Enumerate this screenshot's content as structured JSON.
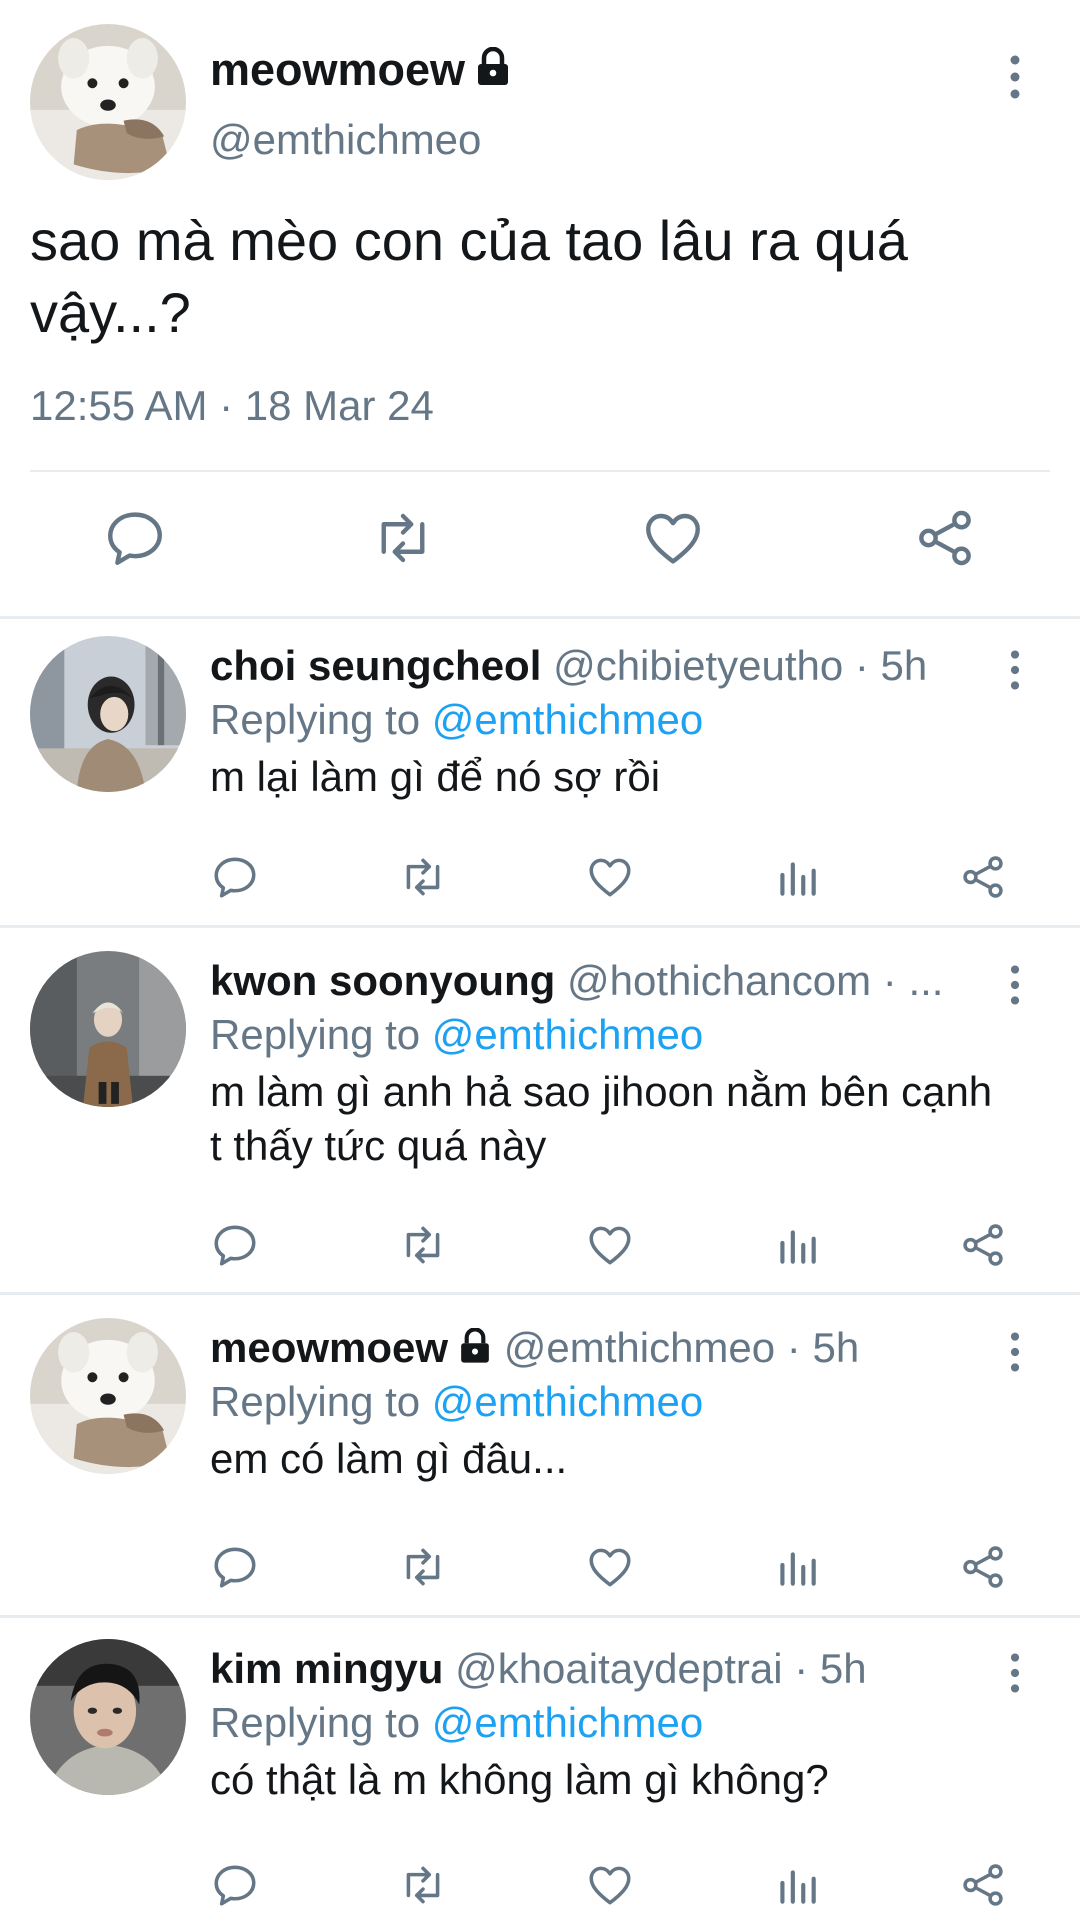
{
  "main_tweet": {
    "display_name": "meowmoew",
    "handle": "@emthichmeo",
    "text": "sao mà mèo con của tao lâu ra quá vậy...?",
    "timestamp": "12:55 AM · 18 Mar 24",
    "protected_icon": "lock-icon",
    "actions": [
      "reply-icon",
      "retweet-icon",
      "like-icon",
      "share-icon"
    ]
  },
  "replies": [
    {
      "display_name": "choi seungcheol",
      "meta": "@chibietyeutho · 5h",
      "replying_prefix": "Replying to",
      "replying_to": "@emthichmeo",
      "text": "m lại làm gì để nó sợ rồi"
    },
    {
      "display_name": "kwon soonyoung",
      "meta": "@hothichancom · ...",
      "replying_prefix": "Replying to",
      "replying_to": "@emthichmeo",
      "text": "m làm gì anh hả sao jihoon nằm bên cạnh t thấy tức quá này"
    },
    {
      "display_name": "meowmoew",
      "meta": "@emthichmeo · 5h",
      "replying_prefix": "Replying to",
      "replying_to": "@emthichmeo",
      "text": "em có làm gì đâu..."
    },
    {
      "display_name": "kim mingyu",
      "meta": "@khoaitaydeptrai · 5h",
      "replying_prefix": "Replying to",
      "replying_to": "@emthichmeo",
      "text": "có thật là m không làm gì không?"
    }
  ],
  "colors": {
    "text": "#14171a",
    "secondary": "#657786",
    "accent": "#1da1f2",
    "divider": "#e6ecf0",
    "icon": "#657786"
  }
}
